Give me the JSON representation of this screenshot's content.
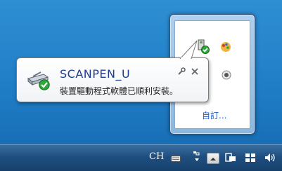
{
  "balloon": {
    "title": "SCANPEN_U",
    "message": "裝置驅動程式軟體已順利安裝。",
    "options_icon": "wrench-icon",
    "close_icon": "close-icon"
  },
  "overflow": {
    "customize_link": "自訂..."
  },
  "taskbar": {
    "language": "CH",
    "icons": [
      "keyboard-icon",
      "pen-icon",
      "show-hidden-icons-icon",
      "action-center-flag-icon",
      "network-icon",
      "volume-icon"
    ]
  },
  "colors": {
    "title": "#1e3d8f",
    "link": "#1f5dbb",
    "taskbar": "#1f4f80",
    "desktop": "#1e7cc5"
  }
}
